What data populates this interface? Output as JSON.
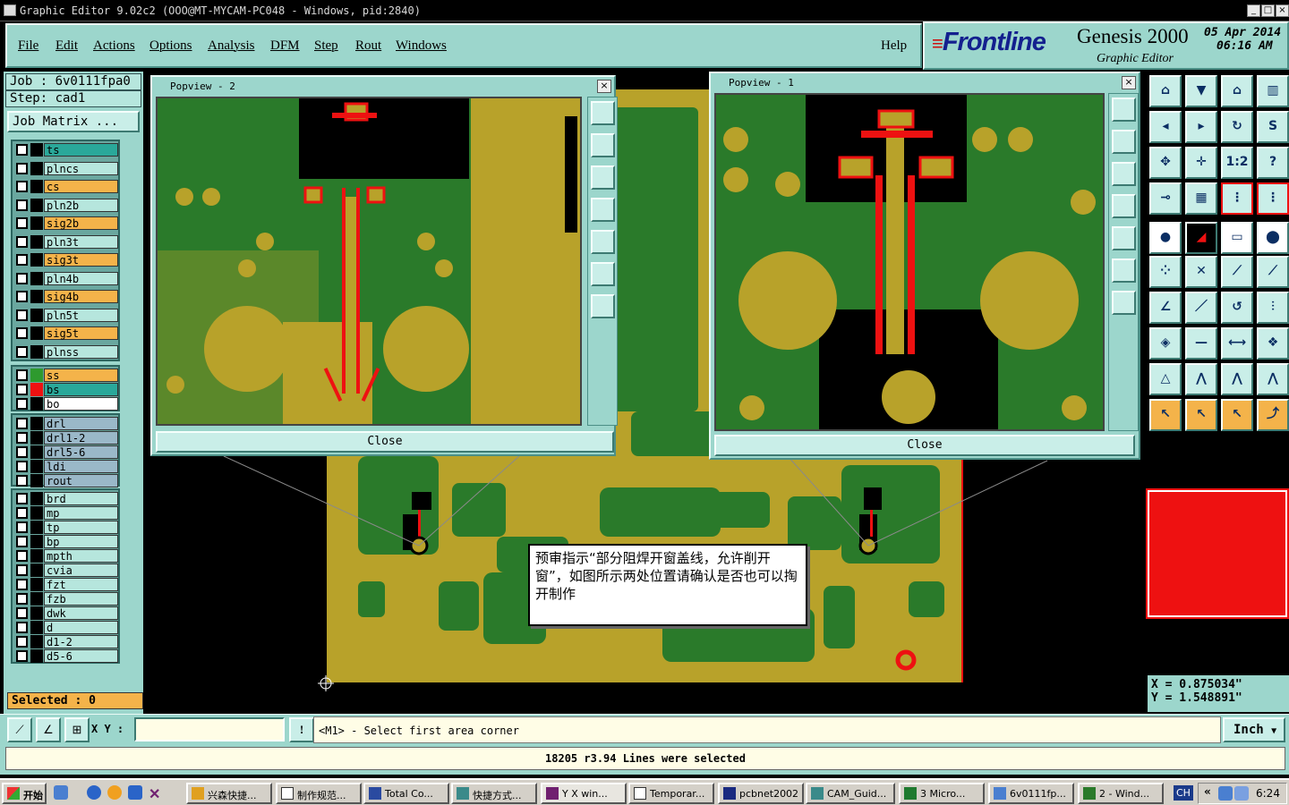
{
  "window": {
    "title": "Graphic Editor 9.02c2  (OOO@MT-MYCAM-PC048 - Windows, pid:2840)",
    "min": "_",
    "max": "□",
    "close": "×"
  },
  "menu": {
    "items": [
      "File",
      "Edit",
      "Actions",
      "Options",
      "Analysis",
      "DFM",
      "Step",
      "Rout",
      "Windows"
    ],
    "help": "Help"
  },
  "brand": {
    "logo": "Frontline",
    "product": "Genesis 2000",
    "subtitle": "Graphic Editor",
    "date": "05 Apr 2014",
    "time": "06:16 AM"
  },
  "job": {
    "job_label": "Job : 6v0111fpa0",
    "step_label": "Step: cad1",
    "matrix_button": "Job Matrix ..."
  },
  "layers_group1": [
    {
      "name": "ts",
      "color": "#2aa89a"
    },
    {
      "name": "plncs",
      "color": "#b6e6dd"
    },
    {
      "name": "cs",
      "color": "#f4b34a"
    },
    {
      "name": "pln2b",
      "color": "#b6e6dd"
    },
    {
      "name": "sig2b",
      "color": "#f4b34a"
    },
    {
      "name": "pln3t",
      "color": "#b6e6dd"
    },
    {
      "name": "sig3t",
      "color": "#f4b34a"
    },
    {
      "name": "pln4b",
      "color": "#b6e6dd"
    },
    {
      "name": "sig4b",
      "color": "#f4b34a"
    },
    {
      "name": "pln5t",
      "color": "#b6e6dd"
    },
    {
      "name": "sig5t",
      "color": "#f4b34a"
    },
    {
      "name": "plnss",
      "color": "#b6e6dd"
    }
  ],
  "layers_group2": [
    {
      "name": "ss",
      "color": "#f4b34a",
      "box": "#2e9a2e"
    },
    {
      "name": "bs",
      "color": "#2aa89a",
      "box": "#ee1111"
    },
    {
      "name": "bo",
      "color": "#ffffff",
      "box": "#000000"
    }
  ],
  "layers_group3": [
    "drl",
    "drl1-2",
    "drl5-6",
    "ldi",
    "rout"
  ],
  "layers_group4": [
    "brd",
    "mp",
    "tp",
    "bp",
    "mpth",
    "cvia",
    "fzt",
    "fzb",
    "dwk",
    "d",
    "d1-2",
    "d5-6"
  ],
  "selected": "Selected : 0",
  "popview2": {
    "title": "Popview - 2",
    "close_label": "Close"
  },
  "popview1": {
    "title": "Popview - 1",
    "close_label": "Close"
  },
  "note": "预审指示“部分阻焊开窗盖线，允许削开窗”，如图所示两处位置请确认是否也可以掏开制作",
  "coords": {
    "x": "X = 0.875034\"",
    "y": "Y = 1.548891\""
  },
  "bottom": {
    "xy_label": "X Y :",
    "xy_value": "",
    "bang": "!",
    "prompt": "<M1> - Select first area corner",
    "unit": "Inch"
  },
  "status": "18205 r3.94 Lines were selected",
  "taskbar": {
    "start": "开始",
    "tasks": [
      "兴森快捷...",
      "制作规范...",
      "Total Co...",
      "快捷方式...",
      "Y X win...",
      "Temporar...",
      "pcbnet2002",
      "CAM_Guid...",
      "3 Micro...",
      "6v0111fp...",
      "2 - Wind..."
    ],
    "lang": "CH",
    "time": "6:24"
  },
  "colors": {
    "panel": "#9cd6cc",
    "copper": "#b8a22a",
    "mask": "#2a7a2a",
    "trace": "#ee1111"
  }
}
